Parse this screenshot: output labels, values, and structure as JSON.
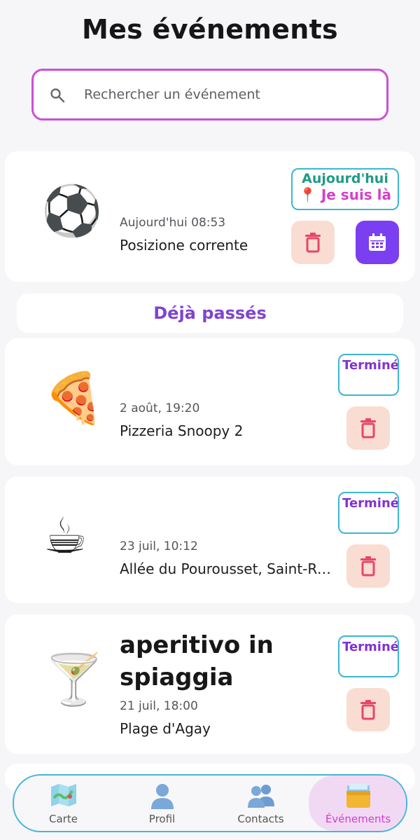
{
  "header": {
    "title": "Mes événements"
  },
  "search": {
    "placeholder": "Rechercher un événement",
    "icon": "search-icon"
  },
  "current_event": {
    "emoji": "⚽",
    "time": "Aujourd'hui 08:53",
    "place": "Posizione corrente",
    "badge_line1": "Aujourd'hui",
    "badge_line2": "📍 Je suis là",
    "delete_icon": "trash-icon",
    "calendar_icon": "calendar-icon"
  },
  "past_section": {
    "title": "Déjà passés"
  },
  "past_events": [
    {
      "emoji": "🍕",
      "time": "2 août, 19:20",
      "place": "Pizzeria Snoopy 2",
      "status": "Terminé"
    },
    {
      "emoji": "☕",
      "time": "23 juil, 10:12",
      "place": "Allée du Pourousset, Saint-Raphaël",
      "status": "Terminé"
    },
    {
      "emoji": "🍸",
      "name": "aperitivo in spiaggia",
      "time": "21 juil, 18:00",
      "place": "Plage d'Agay",
      "status": "Terminé"
    }
  ],
  "nav": [
    {
      "label": "Carte",
      "icon": "map-icon",
      "active": false
    },
    {
      "label": "Profil",
      "icon": "person-icon",
      "active": false
    },
    {
      "label": "Contacts",
      "icon": "people-icon",
      "active": false
    },
    {
      "label": "Événements",
      "icon": "card-box-icon",
      "active": true
    }
  ],
  "colors": {
    "accent_magenta": "#cf4fd6",
    "accent_purple": "#7e44d2",
    "badge_border": "#3cb6d2",
    "delete_bg": "#f9ddd2",
    "delete_icon": "#e8456b",
    "calendar_bg": "#7a3ff0"
  }
}
